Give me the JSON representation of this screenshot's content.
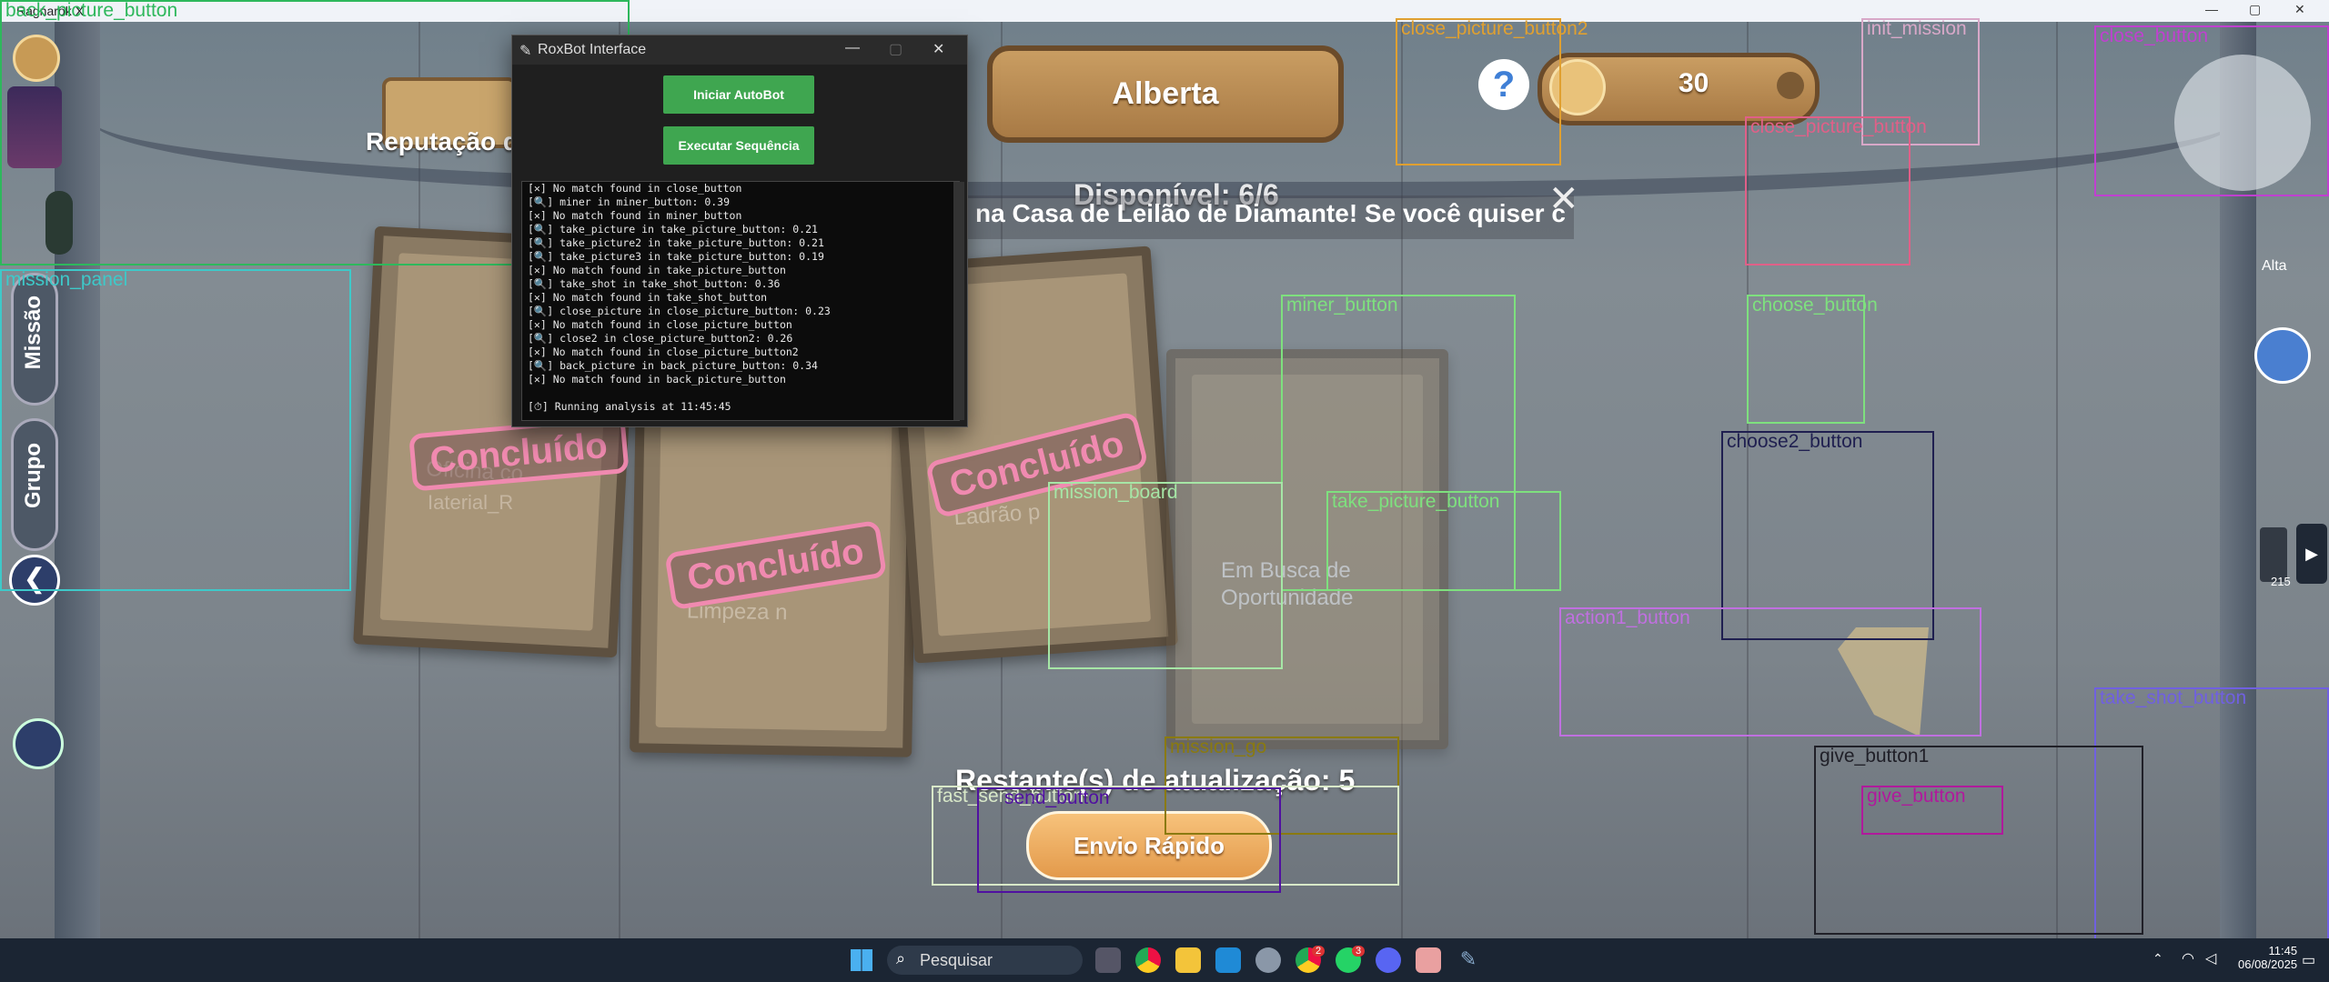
{
  "window": {
    "title": "Ragnarök X"
  },
  "game": {
    "name_plate": "Alberta",
    "coins": "30",
    "help_label": "?",
    "reputation_label": "Reputação d",
    "available": "Disponível: 6/6",
    "marquee": "na Casa de Leilão de Diamante! Se você quiser c",
    "close_glyph": "✕",
    "remaining": "Restante(s) de atualização: 5",
    "fast_send": "Envio Rápido",
    "stamp": "Concluído",
    "card_ghosts": [
      "Oficina co",
      "Iaterial_R",
      "Ladrão p",
      "Limpeza n",
      "Em Busca de",
      "Oportunidade"
    ],
    "side_tabs": [
      "Missão",
      "Grupo"
    ],
    "right_height": "Alta",
    "right_count": "215"
  },
  "overlay": {
    "labels": {
      "back_picture_button": "back_picture_button",
      "mission_panel": "mission_panel",
      "close_picture_button2": "close_picture_button2",
      "init_mission": "init_mission",
      "close_button": "close_button",
      "close_picture_button": "close_picture_button",
      "miner_button": "miner_button",
      "choose_button": "choose_button",
      "choose2_button": "choose2_button",
      "mission_board": "mission_board",
      "take_picture_button": "take_picture_button",
      "action1_button": "action1_button",
      "take_shot_button": "take_shot_button",
      "mission_go": "mission_go",
      "fast_send_button": "fast_send_button",
      "send_button": "send_button",
      "give_button1": "give_button1",
      "give_button": "give_button"
    },
    "colors": {
      "back": "#2eb85c",
      "mission_panel": "#3ec9c9",
      "close2": "#e0a030",
      "init_mission": "#d8a8c8",
      "close": "#c040d0",
      "close_picture": "#e06088",
      "miner": "#7ee07e",
      "choose": "#7ee07e",
      "choose2": "#1f1f50",
      "mission_board": "#a6e6a6",
      "take_picture": "#7ee07e",
      "action1": "#c070e0",
      "take_shot": "#7060e0",
      "mission_go": "#8a7a10",
      "fast_send": "#d8e8c8",
      "send": "#5010a0",
      "give1": "#202028",
      "give": "#b01a9c"
    }
  },
  "roxbot": {
    "title": "RoxBot Interface",
    "btn_start": "Iniciar AutoBot",
    "btn_sequence": "Executar Sequência",
    "log": [
      "[✕] No match found in close_button",
      "[🔍] miner in miner_button: 0.39",
      "[✕] No match found in miner_button",
      "[🔍] take_picture in take_picture_button: 0.21",
      "[🔍] take_picture2 in take_picture_button: 0.21",
      "[🔍] take_picture3 in take_picture_button: 0.19",
      "[✕] No match found in take_picture_button",
      "[🔍] take_shot in take_shot_button: 0.36",
      "[✕] No match found in take_shot_button",
      "[🔍] close_picture in close_picture_button: 0.23",
      "[✕] No match found in close_picture_button",
      "[🔍] close2 in close_picture_button2: 0.26",
      "[✕] No match found in close_picture_button2",
      "[🔍] back_picture in back_picture_button: 0.34",
      "[✕] No match found in back_picture_button",
      "",
      "[⏱] Running analysis at 11:45:45"
    ]
  },
  "taskbar": {
    "search_placeholder": "Pesquisar",
    "time": "11:45",
    "date": "06/08/2025",
    "badge_chrome": "2",
    "badge_whatsapp": "3"
  }
}
